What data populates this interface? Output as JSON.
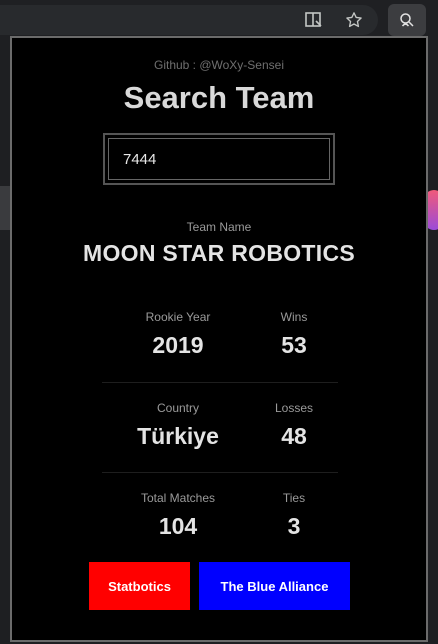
{
  "browser": {
    "icons": [
      "reader-mode-icon",
      "star-bookmark-icon",
      "extension-icon"
    ]
  },
  "popup": {
    "github": "Github : @WoXy-Sensei",
    "title": "Search Team",
    "search": {
      "value": "7444",
      "placeholder": ""
    },
    "team_name_label": "Team Name",
    "team_name": "MOON STAR ROBOTICS",
    "stats": {
      "rookie_year_label": "Rookie Year",
      "rookie_year": "2019",
      "wins_label": "Wins",
      "wins": "53",
      "country_label": "Country",
      "country": "Türkiye",
      "losses_label": "Losses",
      "losses": "48",
      "total_matches_label": "Total Matches",
      "total_matches": "104",
      "ties_label": "Ties",
      "ties": "3"
    },
    "buttons": {
      "statbotics": "Statbotics",
      "tba": "The Blue Alliance"
    },
    "colors": {
      "statbotics": "#ff0000",
      "tba": "#0000ff",
      "background": "#000000",
      "text": "#e4e4e4"
    }
  }
}
